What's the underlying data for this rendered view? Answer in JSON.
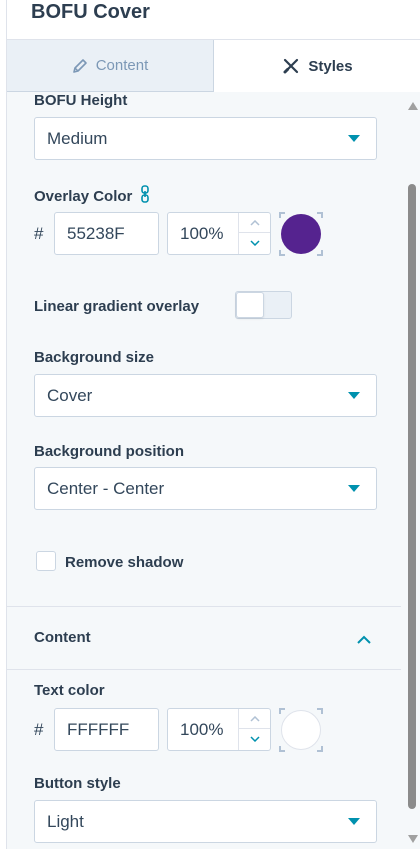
{
  "header": {
    "title": "BOFU Cover"
  },
  "tabs": {
    "content_label": "Content",
    "styles_label": "Styles"
  },
  "fields": {
    "bofu_height": {
      "label": "BOFU Height",
      "value": "Medium"
    },
    "overlay_color": {
      "label": "Overlay Color",
      "hash": "#",
      "hex": "55238F",
      "opacity": "100%",
      "swatch": "#55238F"
    },
    "linear_gradient": {
      "label": "Linear gradient overlay",
      "enabled": false
    },
    "background_size": {
      "label": "Background size",
      "value": "Cover"
    },
    "background_position": {
      "label": "Background position",
      "value": "Center - Center"
    },
    "remove_shadow": {
      "label": "Remove shadow",
      "checked": false
    }
  },
  "content_section": {
    "title": "Content",
    "text_color": {
      "label": "Text color",
      "hash": "#",
      "hex": "FFFFFF",
      "opacity": "100%",
      "swatch": "#FFFFFF"
    },
    "button_style": {
      "label": "Button style",
      "value": "Light"
    }
  },
  "colors": {
    "accent": "#0091AE",
    "text": "#33475B",
    "heading": "#2D3E50"
  },
  "icons": [
    "pencil-icon",
    "styles-icon",
    "link-icon",
    "caret-down-icon",
    "chevron-up-icon",
    "chevron-down-icon"
  ]
}
